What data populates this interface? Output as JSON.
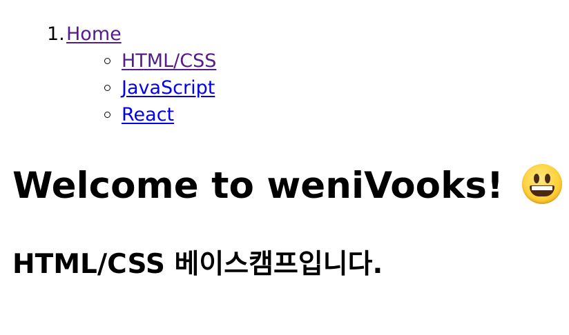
{
  "nav": {
    "marker": "1.",
    "home": {
      "label": "Home",
      "visited": true
    },
    "sub_items": [
      {
        "label": "HTML/CSS",
        "visited": true
      },
      {
        "label": "JavaScript",
        "visited": false
      },
      {
        "label": "React",
        "visited": false
      }
    ]
  },
  "heading": {
    "text": "Welcome to weniVooks!",
    "emoji_icon": "grinning-face-emoji"
  },
  "subheading": {
    "text": "HTML/CSS 베이스캠프입니다."
  },
  "colors": {
    "link_visited": "#551a8b",
    "link_unvisited": "#0000ee",
    "text": "#000000",
    "background": "#ffffff"
  }
}
